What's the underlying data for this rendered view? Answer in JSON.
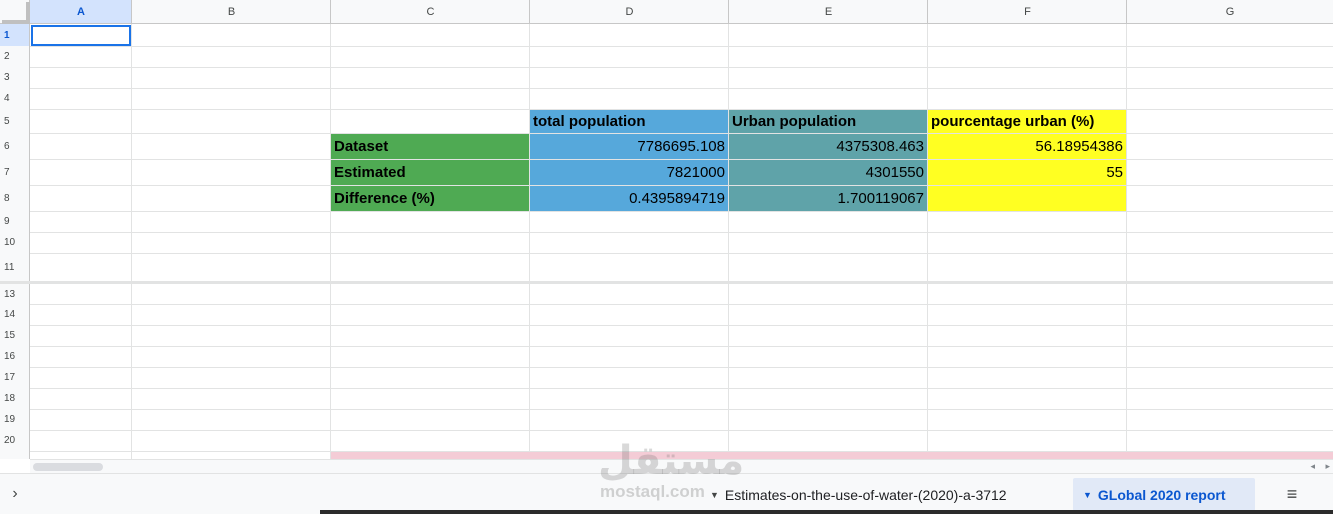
{
  "columns": [
    "A",
    "B",
    "C",
    "D",
    "E",
    "F",
    "G"
  ],
  "rows": [
    "1",
    "2",
    "3",
    "4",
    "5",
    "6",
    "7",
    "8",
    "9",
    "10",
    "11",
    "13",
    "14",
    "15",
    "16",
    "17",
    "18",
    "19",
    "20"
  ],
  "selected_cell": "A1",
  "table": {
    "headers": {
      "d5": "total population",
      "e5": "Urban population",
      "f5": "pourcentage urban (%)"
    },
    "row_labels": {
      "c6": "Dataset",
      "c7": "Estimated",
      "c8": "Difference (%)"
    },
    "values": {
      "d6": "7786695.108",
      "e6": "4375308.463",
      "f6": "56.18954386",
      "d7": "7821000",
      "e7": "4301550",
      "f7": "55",
      "d8": "0.4395894719",
      "e8": "1.700119067",
      "f8": ""
    }
  },
  "colors": {
    "green": "#4faa53",
    "blue": "#56a8db",
    "teal": "#5fa3a9",
    "yellow": "#ffff22",
    "pink": "#f4ccd6",
    "selection": "#1a73e8"
  },
  "sheet_tabs": [
    {
      "label": "Estimates-on-the-use-of-water-(2020)-a-3712",
      "active": false
    },
    {
      "label": "GLobal 2020 report",
      "active": true
    }
  ],
  "watermark": {
    "arabic": "مستقل",
    "latin": "mostaql.com"
  }
}
